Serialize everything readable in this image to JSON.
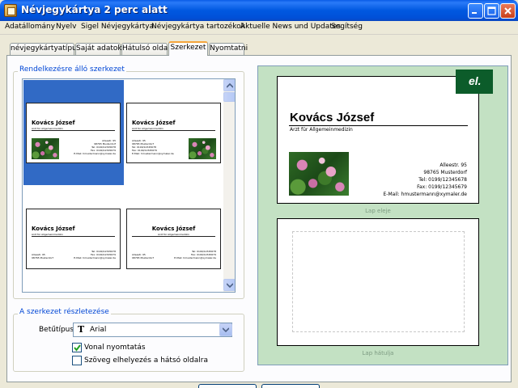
{
  "window": {
    "title": "Névjegykártya 2 perc alatt"
  },
  "menu": [
    "Adatállomány",
    "Nyelv",
    "Sigel Névjegykártya",
    "Névjegykártya tartozékok",
    "Aktuelle News und Updates",
    "Segítség"
  ],
  "tabs": [
    "névjegykártyatípus",
    "Saját adatok",
    "Hátulsó oldal",
    "Szerkezet",
    "Nyomtatni"
  ],
  "active_tab": "Szerkezet",
  "layouts_group": {
    "label": "Rendelkezésre álló szerkezet"
  },
  "mini_card": {
    "name": "Kovács József",
    "subtitle": "Arzt für Allgemeinmedizin",
    "address_lines": [
      "Alleestr. 95",
      "98765 Musterdorf",
      "Tel: 0199/12345678",
      "Fax: 0199/12345679",
      "E-Mail: hmustermann@xymaler.de"
    ],
    "address_lines_short": [
      "Alleestr. 95",
      "98765 Musterdorf"
    ],
    "contact_lines_short": [
      "Tel: 0199/12345678",
      "Fax: 0199/12345679",
      "E-Mail: hmustermann@xymaler.de"
    ]
  },
  "details_group": {
    "label": "A szerkezet részletezése",
    "font_label": "Betűtípus",
    "font_value": "Arial",
    "font_icon": "T",
    "checkbox_line": {
      "label": "Vonal nyomtatás",
      "checked": true
    },
    "checkbox_back": {
      "label": "Szöveg elhelyezés a hátsó oldalra",
      "checked": false
    }
  },
  "preview": {
    "front": {
      "name": "Kovács József",
      "subtitle": "Arzt für Allgemeinmedizin",
      "address": [
        "Alleestr. 95",
        "98765 Musterdorf",
        "Tel: 0199/12345678",
        "Fax: 0199/12345679",
        "E-Mail: hmustermann@xymaler.de"
      ]
    },
    "logo_text": "el.",
    "front_label": "Lap eleje",
    "back_label": "Lap hátulja"
  },
  "colors": {
    "selection": "#316ac5",
    "preview_bg": "#c3e1c3",
    "group_label": "#0046d5",
    "tab_highlight": "#f5a53c"
  },
  "icons": [
    "app-icon",
    "minimize-icon",
    "maximize-icon",
    "close-icon",
    "scroll-up-icon",
    "scroll-down-icon",
    "dropdown-arrow-icon",
    "font-type-icon",
    "checkmark-icon",
    "lotus-photo"
  ]
}
